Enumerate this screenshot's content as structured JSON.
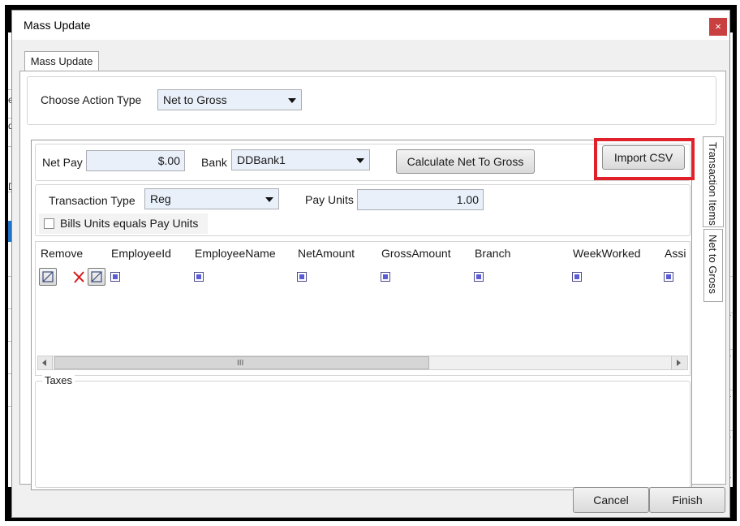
{
  "window": {
    "title": "Mass Update",
    "close_glyph": "×"
  },
  "tabs": {
    "main": "Mass Update"
  },
  "action": {
    "label": "Choose Action Type",
    "value": "Net to Gross"
  },
  "net_to_gross": {
    "net_pay_label": "Net Pay",
    "net_pay_value": "$.00",
    "bank_label": "Bank",
    "bank_value": "DDBank1",
    "calc_button": "Calculate Net To Gross",
    "import_button": "Import CSV",
    "transaction_type_label": "Transaction Type",
    "transaction_type_value": "Reg",
    "pay_units_label": "Pay Units",
    "pay_units_value": "1.00",
    "bills_units_label": "Bills Units equals Pay Units"
  },
  "grid": {
    "columns": [
      "Remove",
      "EmployeeId",
      "EmployeeName",
      "NetAmount",
      "GrossAmount",
      "Branch",
      "WeekWorked",
      "Assi"
    ],
    "scroll_grip": "III"
  },
  "taxes": {
    "label": "Taxes"
  },
  "side_tabs": {
    "transaction_items": "Transaction Items",
    "net_to_gross": "Net to Gross"
  },
  "footer": {
    "cancel": "Cancel",
    "finish": "Finish"
  },
  "background": {
    "left_chars": [
      "e",
      "d",
      "D"
    ],
    "right_chars": [
      "a",
      "a",
      "a",
      "a",
      "a"
    ]
  },
  "colors": {
    "highlight": "#e0202a",
    "close": "#c84040",
    "field_bg": "#e9f0fa"
  }
}
